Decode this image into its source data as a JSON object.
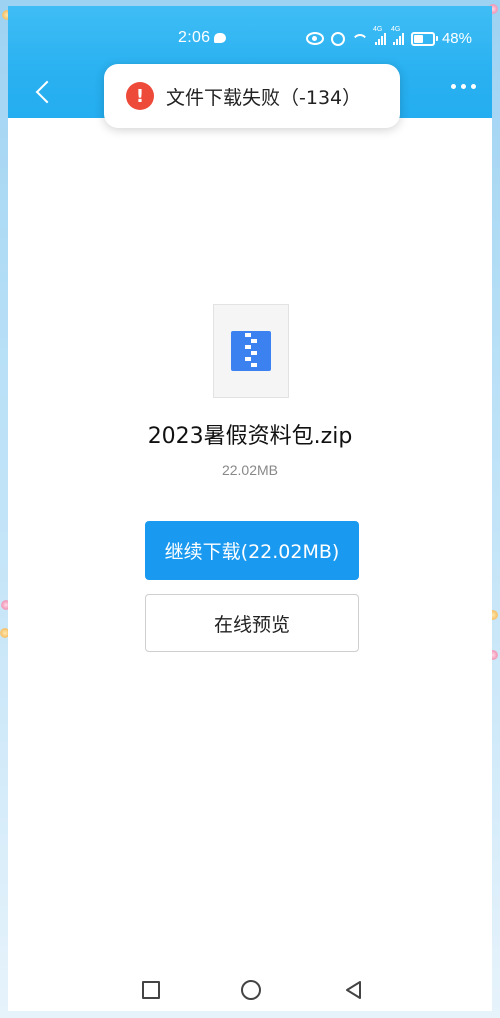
{
  "status_bar": {
    "time": "2:06",
    "battery_percent": "48%",
    "network_tag_1": "4G",
    "network_tag_2": "4G",
    "icons": [
      "chat-icon",
      "eye-icon",
      "alarm-icon",
      "wifi-icon",
      "signal-icon",
      "signal-icon",
      "battery-icon"
    ]
  },
  "header": {
    "back_icon": "chevron-left-icon",
    "more_icon": "more-dots-icon"
  },
  "toast": {
    "icon": "error-icon",
    "icon_glyph": "!",
    "message": "文件下载失败（-134）"
  },
  "file": {
    "icon": "zip-file-icon",
    "name": "2023暑假资料包.zip",
    "size": "22.02MB"
  },
  "actions": {
    "download_label": "继续下载(22.02MB)",
    "preview_label": "在线预览"
  },
  "nav_bar": {
    "recent_icon": "square-icon",
    "home_icon": "circle-icon",
    "back_icon": "triangle-back-icon"
  },
  "colors": {
    "header_blue": "#29b1f1",
    "primary_button": "#1a99f0",
    "error_red": "#ee4a3a",
    "zip_blue": "#3b82f0"
  }
}
